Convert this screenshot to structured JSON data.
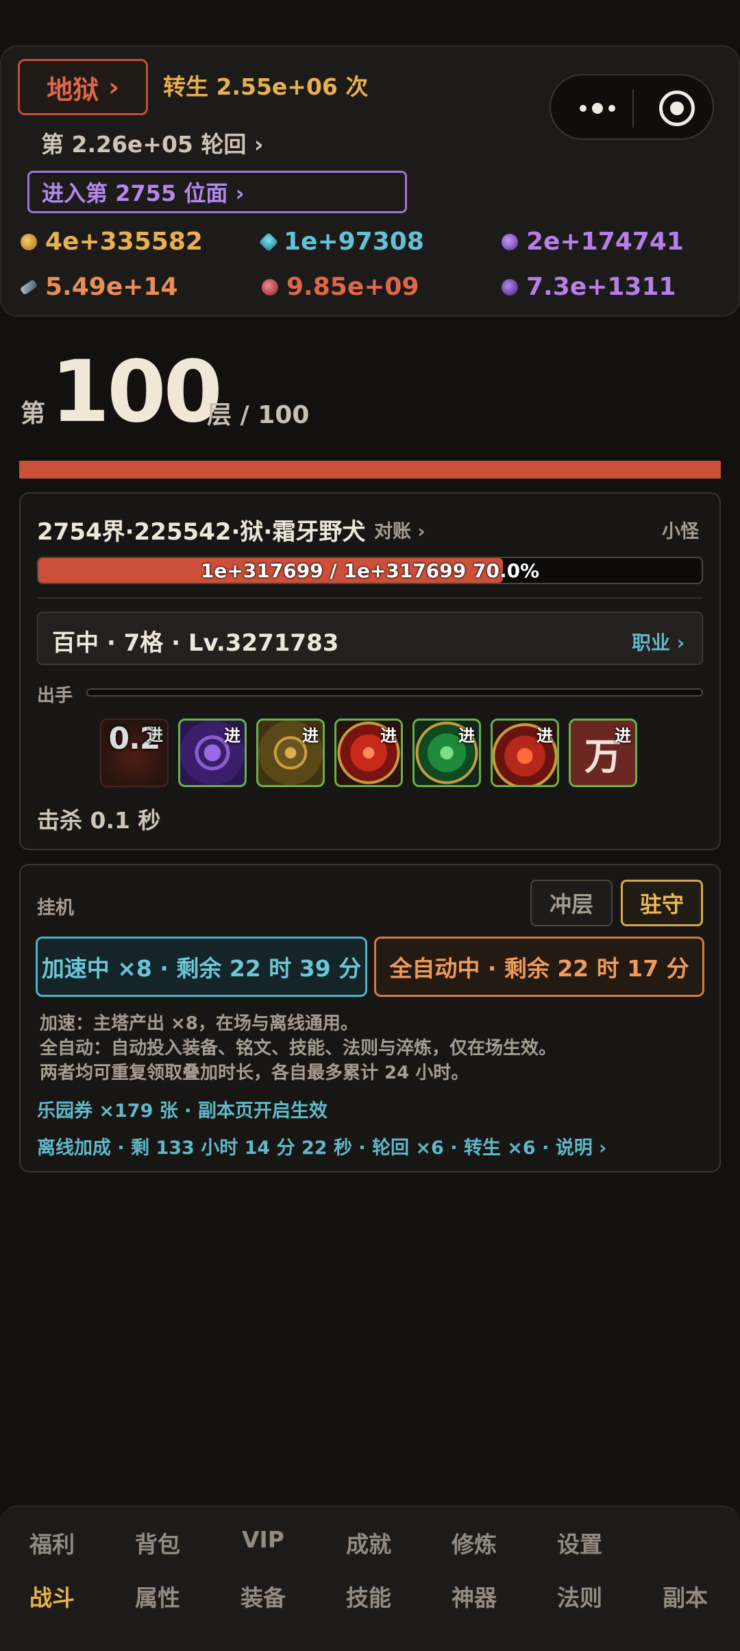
{
  "header": {
    "realm_label": "地狱",
    "realm_chevron": "›",
    "rebirth_text": "转生 2.55e+06 次",
    "samsara_text": "第 2.26e+05 轮回 ›",
    "enter_plane_text": "进入第 2755 位面 ›"
  },
  "resources": [
    {
      "icon": "gold-coin-icon",
      "value": "4e+335582",
      "color": "#e8b04e"
    },
    {
      "icon": "cyan-gem-icon",
      "value": "1e+97308",
      "color": "#62c3d6"
    },
    {
      "icon": "purple-orb-icon",
      "value": "2e+174741",
      "color": "#b77ee8"
    },
    {
      "icon": "whetstone-icon",
      "value": "5.49e+14",
      "color": "#e98f56"
    },
    {
      "icon": "red-crystal-icon",
      "value": "9.85e+09",
      "color": "#e0664a"
    },
    {
      "icon": "violet-rune-icon",
      "value": "7.3e+1311",
      "color": "#b77ee8"
    }
  ],
  "floor": {
    "prefix": "第",
    "current": "100",
    "suffix": "层 / 100"
  },
  "battle": {
    "enemy_name": "2754界·225542·狱·霜牙野犬",
    "check_link": "对账 ›",
    "enemy_type": "小怪",
    "hp_text": "1e+317699 / 1e+317699   70.0%",
    "hp_fraction": 0.7,
    "class_text": "百中 · 7格 · Lv.3271783",
    "class_link": "职业 ›",
    "attack_label": "出手",
    "skills": [
      {
        "name": "dark-skill-icon",
        "cooldown": "0.2",
        "badge": "进"
      },
      {
        "name": "purple-target-skill-icon",
        "cooldown": "",
        "badge": "进"
      },
      {
        "name": "golden-rune-skill-icon",
        "cooldown": "",
        "badge": "进"
      },
      {
        "name": "red-vortex-skill-icon",
        "cooldown": "",
        "badge": "进"
      },
      {
        "name": "green-dragon-skill-icon",
        "cooldown": "",
        "badge": "进"
      },
      {
        "name": "flame-beast-skill-icon",
        "cooldown": "",
        "badge": "进"
      },
      {
        "name": "wan-character-skill-icon",
        "cooldown": "",
        "badge": "进",
        "glyph": "万"
      }
    ],
    "kill_time": "击杀 0.1 秒"
  },
  "idle": {
    "title": "挂机",
    "mode_climb": "冲层",
    "mode_guard": "驻守",
    "boost_text": "加速中 ×8 · 剩余 22 时 39 分",
    "auto_text": "全自动中 · 剩余 22 时 17 分",
    "note_1": "加速：主塔产出 ×8，在场与离线通用。",
    "note_2": "全自动：自动投入装备、铭文、技能、法则与淬炼，仅在场生效。",
    "note_3": "两者均可重复领取叠加时长，各自最多累计 24 小时。",
    "ticket_line": "乐园券 ×179 张 · 副本页开启生效",
    "offline_line": "离线加成 · 剩 133 小时 14 分 22 秒 · 轮回 ×6 · 转生 ×6 · 说明 ›"
  },
  "nav": {
    "row1": [
      "福利",
      "背包",
      "VIP",
      "成就",
      "修炼",
      "设置"
    ],
    "row2": [
      "战斗",
      "属性",
      "装备",
      "技能",
      "神器",
      "法则",
      "副本"
    ],
    "active": "战斗"
  }
}
